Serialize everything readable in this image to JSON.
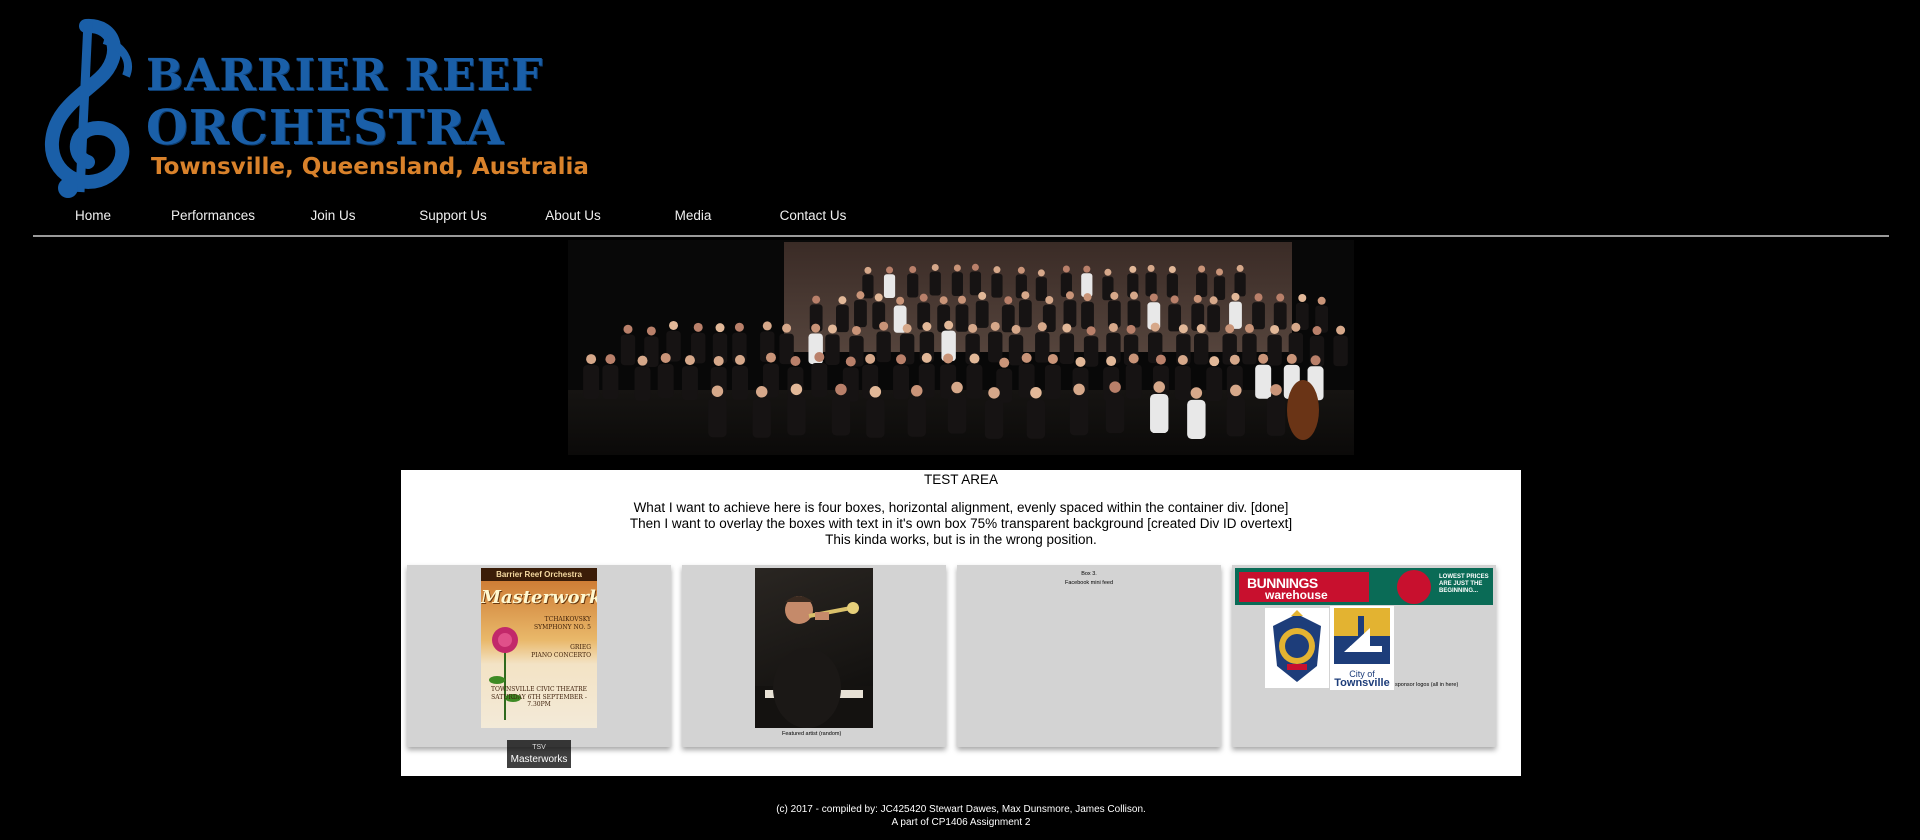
{
  "logo": {
    "line1": "BARRIER REEF",
    "line2": "ORCHESTRA",
    "line3": "Townsville, Queensland, Australia",
    "colors": {
      "primary": "#1a5fa8",
      "accent": "#d9822b"
    }
  },
  "nav": {
    "items": [
      {
        "label": "Home"
      },
      {
        "label": "Performances"
      },
      {
        "label": "Join Us"
      },
      {
        "label": "Support Us"
      },
      {
        "label": "About Us"
      },
      {
        "label": "Media"
      },
      {
        "label": "Contact Us"
      }
    ]
  },
  "test_area": {
    "title": "TEST AREA",
    "lines": [
      "What I want to achieve here is four boxes, horizontal alignment, evenly spaced within the container div. [done]",
      "Then I want to overlay the boxes with text in it's own box 75% transparent background [created Div ID overtext]",
      "This kinda works, but is in the wrong position."
    ]
  },
  "boxes": {
    "box1": {
      "poster_header": "Barrier Reef Orchestra",
      "poster_title": "Masterworks",
      "poster_lines": [
        "TCHAIKOVSKY",
        "SYMPHONY NO. 5",
        "GRIEG",
        "PIANO CONCERTO"
      ],
      "poster_footer": [
        "TOWNSVILLE CIVIC THEATRE",
        "SATURDAY 6TH SEPTEMBER - 7.30PM"
      ],
      "overtext_tag": "TSV",
      "overtext_label": "Masterworks"
    },
    "box2": {
      "caption": "Featured artist (random)"
    },
    "box3": {
      "line1": "Box 3.",
      "line2": "Facebook mini feed"
    },
    "box4": {
      "bunnings_name": "BUNNINGS",
      "bunnings_sub": "warehouse",
      "bunnings_tag": "LOWEST PRICES ARE JUST THE BEGINNING...",
      "city_prefix": "City of",
      "city_name": "Townsville",
      "caption": "sponsor logos (all in here)"
    }
  },
  "footer": {
    "line1": "(c) 2017 - compiled by: JC425420 Stewart Dawes, Max Dunsmore, James Collison.",
    "line2": "A part of CP1406 Assignment 2"
  }
}
